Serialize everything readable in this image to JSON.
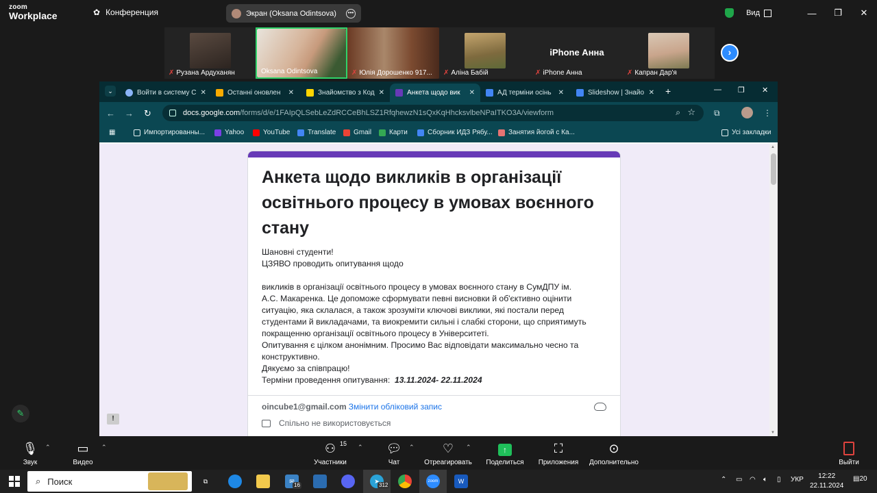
{
  "zoom": {
    "logo_line1": "zoom",
    "logo_line2": "Workplace",
    "conference_label": "Конференция",
    "screen_share_label": "Экран (Oksana Odintsova)",
    "view_label": "Вид",
    "accent_color": "#2d8cff"
  },
  "gallery": [
    {
      "name": "Рузана Ардуханян",
      "muted": true
    },
    {
      "name": "Oksana Odintsova",
      "muted": false,
      "active": true
    },
    {
      "name": "Юлія Дорошенко 917...",
      "muted": true
    },
    {
      "name": "Аліна Бабій",
      "muted": true
    },
    {
      "name": "iPhone Анна",
      "big_label": "iPhone Анна",
      "muted": true
    },
    {
      "name": "Капран Дар'я",
      "muted": true
    }
  ],
  "browser": {
    "tabs": [
      {
        "label": "Войти в систему С",
        "color": "#8ab4f8"
      },
      {
        "label": "Останні оновлен",
        "color": "#f9ab00"
      },
      {
        "label": "Знайомство з Код",
        "color": "#ffd500"
      },
      {
        "label": "Анкета щодо вик",
        "color": "#673ab7",
        "active": true
      },
      {
        "label": "АД терміни осінь",
        "color": "#4285f4"
      },
      {
        "label": "Slideshow | Знайо",
        "color": "#4285f4"
      }
    ],
    "url_domain": "docs.google.com",
    "url_path": "/forms/d/e/1FAIpQLSebLeZdRCCeBhLSZ1RfqhewzN1sQxKqHhcksvlbeNPaITKO3A/viewform",
    "bookmarks": [
      {
        "label": "Импортированны...",
        "color": "#e6f1f2"
      },
      {
        "label": "Yahoo",
        "color": "#7b3fe4"
      },
      {
        "label": "YouTube",
        "color": "#ff0000"
      },
      {
        "label": "Translate",
        "color": "#4285f4"
      },
      {
        "label": "Gmail",
        "color": "#ea4335"
      },
      {
        "label": "Карти",
        "color": "#34a853"
      },
      {
        "label": "Сборник ИДЗ Рябу...",
        "color": "#4285f4"
      },
      {
        "label": "Занятия йогой с Ка...",
        "color": "#e57373"
      }
    ],
    "all_bookmarks_label": "Усі закладки"
  },
  "form": {
    "title": "Анкета щодо викликів в  організації освітнього процесу в умовах воєнного стану",
    "lines": [
      "Шановні студенти!",
      "ЦЗЯВО проводить опитування щодо",
      "",
      "викликів в  організації освітнього процесу в умовах воєнного стану   в СумДПУ ім.",
      "А.С. Макаренка. Це допоможе сформувати певні висновки й об'єктивно оцінити",
      "ситуацію, яка склалася, а також зрозуміти ключові виклики, які постали перед",
      "студентами й викладачами, та виокремити сильні і слабкі сторони, що сприятимуть",
      "покращенню організації освітнього процесу  в Університеті.",
      "Опитування є цілком анонімним. Просимо Вас відповідати максимально чесно та",
      "конструктивно.",
      "Дякуємо за співпрацю!"
    ],
    "dates_label": "Терміни проведення опитування:  ",
    "dates_value": "13.11.2024- 22.11.2024",
    "account_email": "oincube1@gmail.com",
    "switch_account": "Змінити обліковий запис",
    "not_shared": "Спільно не використовується",
    "accent_color": "#673ab7"
  },
  "controls": {
    "audio": "Звук",
    "video": "Видео",
    "participants": "Участники",
    "participants_count": "15",
    "chat": "Чат",
    "react": "Отреагировать",
    "share": "Поделиться",
    "apps": "Приложения",
    "more": "Дополнительно",
    "leave": "Выйти"
  },
  "taskbar": {
    "search_placeholder": "Поиск",
    "mail_badge": "16",
    "telegram_badge": "312",
    "language": "УКР",
    "time": "12:22",
    "date": "22.11.2024",
    "notifications": "20"
  }
}
